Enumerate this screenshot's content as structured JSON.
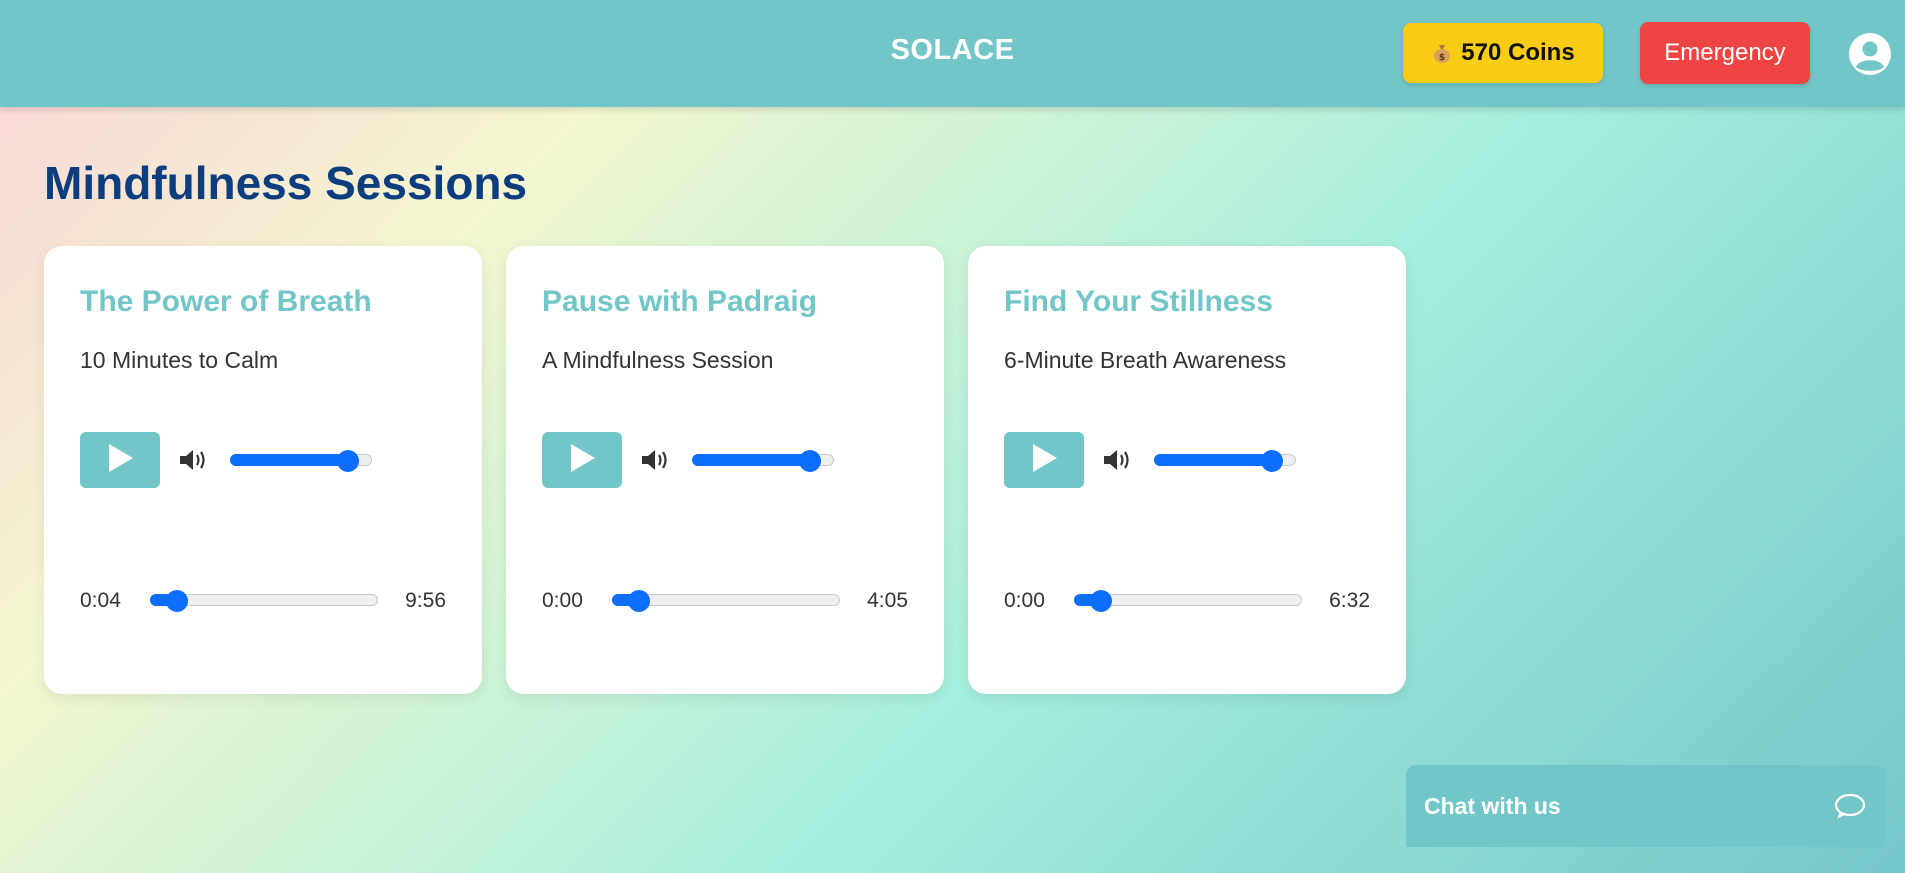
{
  "header": {
    "brand": "SOLACE",
    "coins_label": "570 Coins",
    "coins_icon": "money-bag-icon",
    "emergency_label": "Emergency",
    "profile_icon": "user-circle-icon",
    "colors": {
      "header_bg": "#73c6c8",
      "coins_bg": "#facc15",
      "emergency_bg": "#ef4444"
    }
  },
  "main": {
    "title": "Mindfulness Sessions",
    "sessions": [
      {
        "title": "The Power of Breath",
        "subtitle": "10 Minutes to Calm",
        "current_time": "0:04",
        "duration": "9:56",
        "volume": 0.83,
        "progress": 0.12
      },
      {
        "title": "Pause with Padraig",
        "subtitle": "A Mindfulness Session",
        "current_time": "0:00",
        "duration": "4:05",
        "volume": 0.83,
        "progress": 0.12
      },
      {
        "title": "Find Your Stillness",
        "subtitle": "6-Minute Breath Awareness",
        "current_time": "0:00",
        "duration": "6:32",
        "volume": 0.83,
        "progress": 0.12
      }
    ]
  },
  "chat": {
    "label": "Chat with us",
    "icon": "speech-bubble-icon"
  },
  "colors": {
    "accent": "#73c6c8",
    "title": "#0c3d7e",
    "slider": "#0d6efd"
  }
}
